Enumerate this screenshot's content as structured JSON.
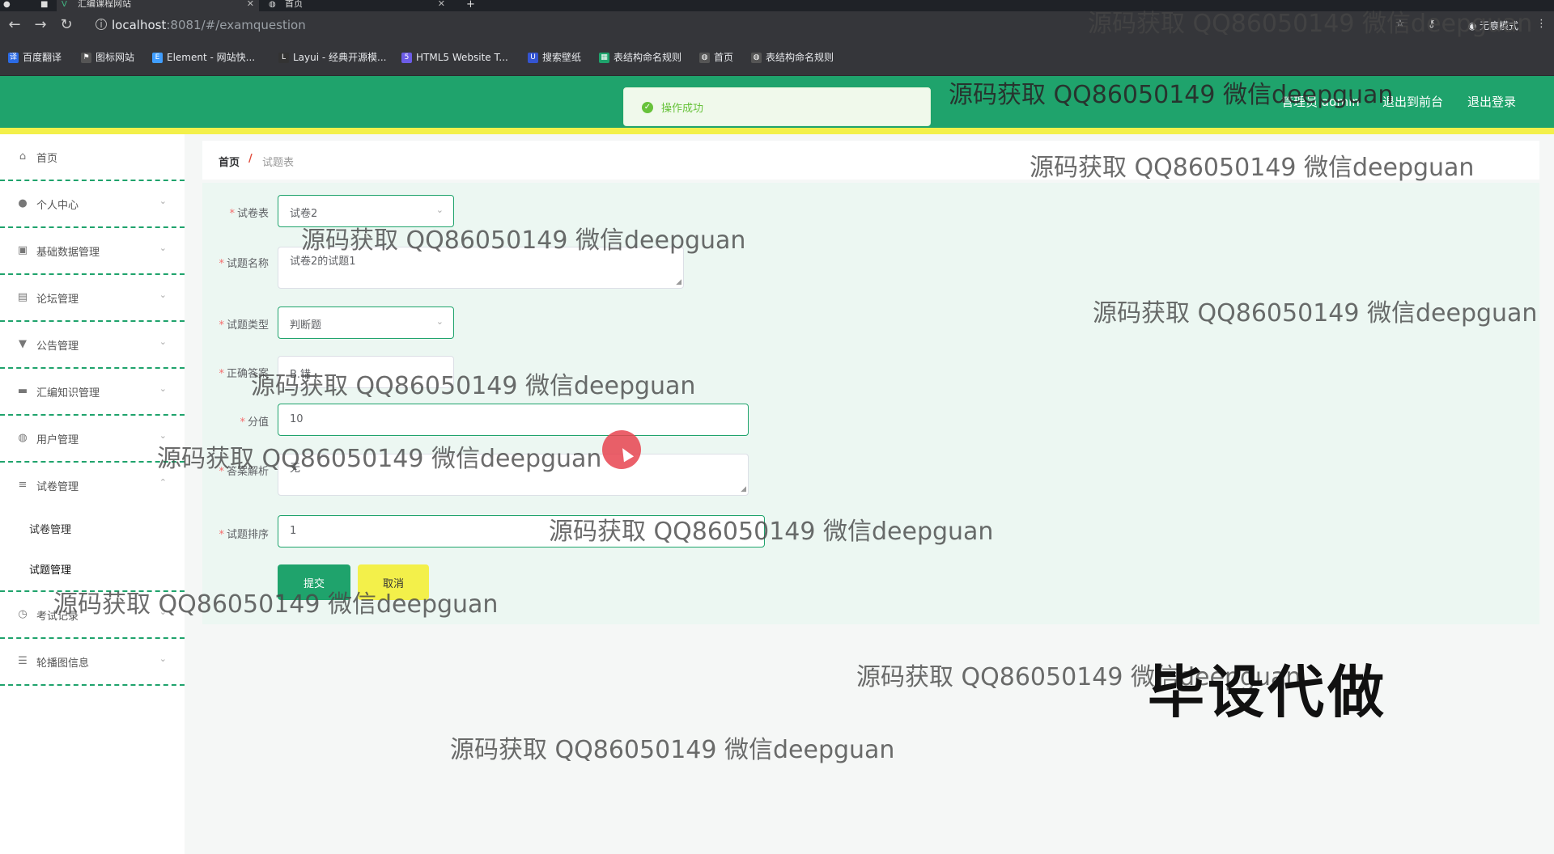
{
  "browser": {
    "tabs": [
      {
        "title": "汇编课程网站",
        "icon": "vue-icon"
      },
      {
        "title": "首页",
        "icon": "globe-icon"
      }
    ],
    "url_host": "localhost",
    "url_path": ":8081/#/examquestion",
    "incognito_label": "无痕模式",
    "bookmarks": [
      {
        "label": "百度翻译",
        "icon": "translate-icon",
        "color": "#2b6be6"
      },
      {
        "label": "图标网站",
        "icon": "flag-icon",
        "color": "#555555"
      },
      {
        "label": "Element - 网站快...",
        "icon": "element-icon",
        "color": "#409eff"
      },
      {
        "label": "Layui - 经典开源模...",
        "icon": "layui-icon",
        "color": "#333333"
      },
      {
        "label": "HTML5 Website T...",
        "icon": "html5-icon",
        "color": "#6c5ce7"
      },
      {
        "label": "搜索壁纸",
        "icon": "wallpaper-icon",
        "color": "#3454d1"
      },
      {
        "label": "表结构命名规则",
        "icon": "table-icon",
        "color": "#1fa36c"
      },
      {
        "label": "首页",
        "icon": "globe-icon",
        "color": "#555555"
      },
      {
        "label": "表结构命名规则",
        "icon": "globe-icon",
        "color": "#555555"
      }
    ]
  },
  "header": {
    "toast": "操作成功",
    "user": "管理员 admin",
    "to_front": "退出到前台",
    "logout": "退出登录"
  },
  "sidebar": {
    "items": [
      {
        "label": "首页",
        "icon": "home-icon"
      },
      {
        "label": "个人中心",
        "icon": "user-icon"
      },
      {
        "label": "基础数据管理",
        "icon": "building-icon"
      },
      {
        "label": "论坛管理",
        "icon": "document-icon"
      },
      {
        "label": "公告管理",
        "icon": "pin-icon"
      },
      {
        "label": "汇编知识管理",
        "icon": "briefcase-icon"
      },
      {
        "label": "用户管理",
        "icon": "globe-icon"
      },
      {
        "label": "试卷管理",
        "icon": "list-icon"
      }
    ],
    "subitems": [
      "试卷管理",
      "试题管理"
    ],
    "after": [
      {
        "label": "考试记录",
        "icon": "clock-icon"
      },
      {
        "label": "轮播图信息",
        "icon": "sliders-icon"
      }
    ]
  },
  "breadcrumb": {
    "home": "首页",
    "sep": "/",
    "current": "试题表"
  },
  "form": {
    "paper_label": "试卷表",
    "paper_value": "试卷2",
    "name_label": "试题名称",
    "name_value": "试卷2的试题1",
    "type_label": "试题类型",
    "type_value": "判断题",
    "answer_label": "正确答案",
    "answer_value": "B.错",
    "score_label": "分值",
    "score_value": "10",
    "analysis_label": "答案解析",
    "analysis_value": "无",
    "order_label": "试题排序",
    "order_value": "1",
    "submit": "提交",
    "cancel": "取消"
  },
  "watermarks": {
    "text": "源码获取 QQ86050149 微信deepguan",
    "stamp": "毕设代做"
  }
}
